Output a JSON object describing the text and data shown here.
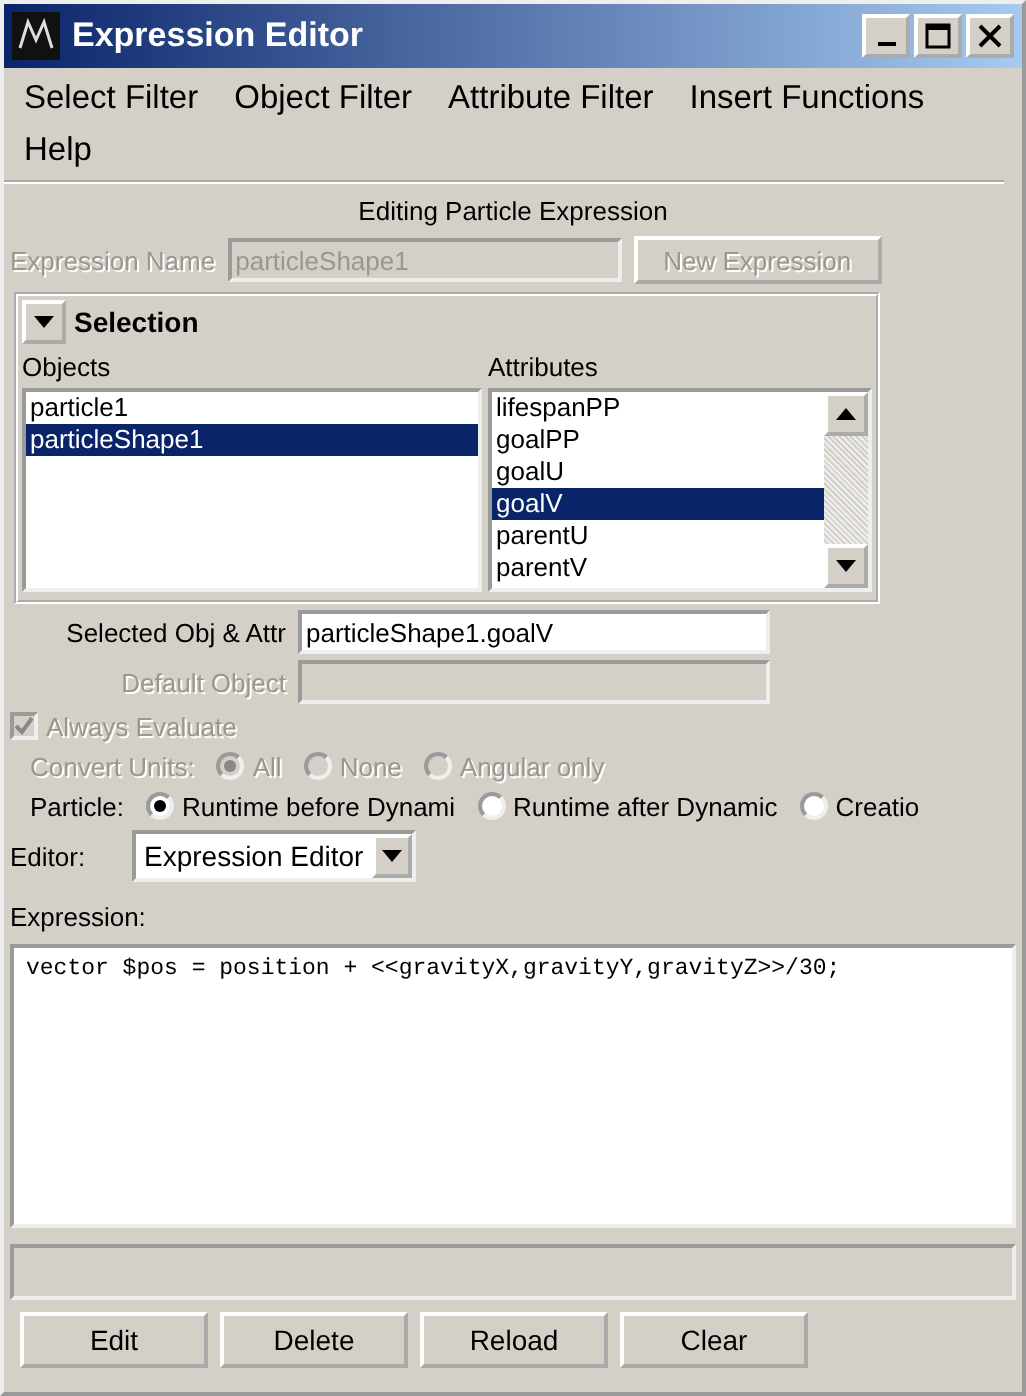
{
  "window": {
    "title": "Expression Editor"
  },
  "menu": [
    "Select Filter",
    "Object Filter",
    "Attribute Filter",
    "Insert Functions",
    "Help"
  ],
  "heading": "Editing Particle Expression",
  "expression_name": {
    "label": "Expression Name",
    "value": "particleShape1",
    "disabled": true
  },
  "new_expression_button": {
    "label": "New Expression",
    "disabled": true
  },
  "selection": {
    "title": "Selection",
    "expanded": true,
    "objects_label": "Objects",
    "attributes_label": "Attributes",
    "objects": [
      {
        "label": "particle1",
        "selected": false
      },
      {
        "label": "particleShape1",
        "selected": true
      }
    ],
    "attributes": [
      {
        "label": "lifespanPP",
        "selected": false
      },
      {
        "label": "goalPP",
        "selected": false
      },
      {
        "label": "goalU",
        "selected": false
      },
      {
        "label": "goalV",
        "selected": true
      },
      {
        "label": "parentU",
        "selected": false
      },
      {
        "label": "parentV",
        "selected": false
      }
    ]
  },
  "selected_obj_attr": {
    "label": "Selected Obj & Attr",
    "value": "particleShape1.goalV"
  },
  "default_object": {
    "label": "Default Object",
    "disabled": true
  },
  "always_evaluate": {
    "label": "Always Evaluate",
    "checked": true,
    "disabled": true
  },
  "convert_units": {
    "label": "Convert Units:",
    "disabled": true,
    "options": [
      {
        "label": "All",
        "selected": true
      },
      {
        "label": "None",
        "selected": false
      },
      {
        "label": "Angular only",
        "selected": false
      }
    ]
  },
  "particle": {
    "label": "Particle:",
    "options": [
      {
        "label": "Runtime before Dynami",
        "selected": true
      },
      {
        "label": "Runtime after Dynamic",
        "selected": false
      },
      {
        "label": "Creatio",
        "selected": false
      }
    ]
  },
  "editor": {
    "label": "Editor:",
    "value": "Expression Editor"
  },
  "expression": {
    "label": "Expression:",
    "text": "vector $pos = position + <<gravityX,gravityY,gravityZ>>/30;"
  },
  "buttons": [
    "Edit",
    "Delete",
    "Reload",
    "Clear"
  ]
}
